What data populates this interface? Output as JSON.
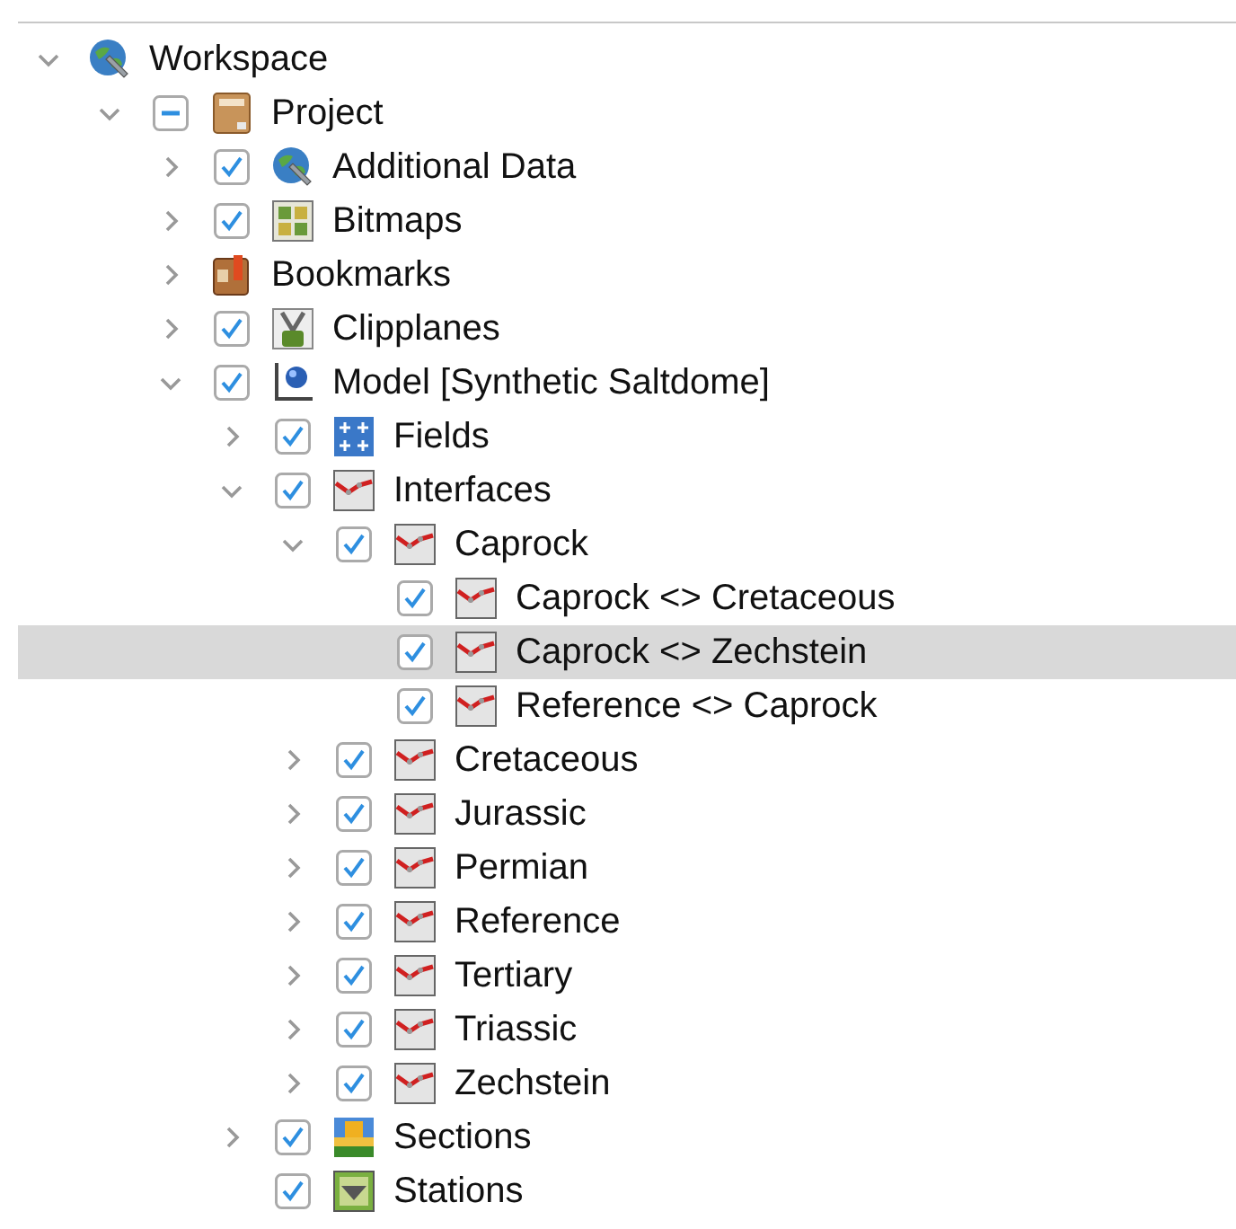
{
  "tree": [
    {
      "label": "Workspace",
      "kind": "workspace",
      "expanded": true,
      "selected": false,
      "children": [
        {
          "label": "Project",
          "kind": "project",
          "partial": true,
          "expanded": true,
          "selected": false,
          "children": [
            {
              "label": "Additional Data",
              "kind": "workspace",
              "checked": true,
              "expanded": false,
              "selected": false
            },
            {
              "label": "Bitmaps",
              "kind": "bitmap",
              "checked": true,
              "expanded": false,
              "selected": false
            },
            {
              "label": "Bookmarks",
              "kind": "bookmark",
              "expanded": false,
              "selected": false
            },
            {
              "label": "Clipplanes",
              "kind": "clipplane",
              "checked": true,
              "expanded": false,
              "selected": false
            },
            {
              "label": "Model [Synthetic Saltdome]",
              "kind": "model",
              "checked": true,
              "expanded": true,
              "selected": false,
              "children": [
                {
                  "label": "Fields",
                  "kind": "field",
                  "checked": true,
                  "expanded": false,
                  "selected": false
                },
                {
                  "label": "Interfaces",
                  "kind": "interface",
                  "checked": true,
                  "expanded": true,
                  "selected": false,
                  "children": [
                    {
                      "label": "Caprock",
                      "kind": "interface",
                      "checked": true,
                      "expanded": true,
                      "selected": false,
                      "children": [
                        {
                          "label": "Caprock <> Cretaceous",
                          "kind": "interface",
                          "checked": true,
                          "selected": false
                        },
                        {
                          "label": "Caprock <> Zechstein",
                          "kind": "interface",
                          "checked": true,
                          "selected": true
                        },
                        {
                          "label": "Reference <> Caprock",
                          "kind": "interface",
                          "checked": true,
                          "selected": false
                        }
                      ]
                    },
                    {
                      "label": "Cretaceous",
                      "kind": "interface",
                      "checked": true,
                      "expanded": false,
                      "selected": false
                    },
                    {
                      "label": "Jurassic",
                      "kind": "interface",
                      "checked": true,
                      "expanded": false,
                      "selected": false
                    },
                    {
                      "label": "Permian",
                      "kind": "interface",
                      "checked": true,
                      "expanded": false,
                      "selected": false
                    },
                    {
                      "label": "Reference",
                      "kind": "interface",
                      "checked": true,
                      "expanded": false,
                      "selected": false
                    },
                    {
                      "label": "Tertiary",
                      "kind": "interface",
                      "checked": true,
                      "expanded": false,
                      "selected": false
                    },
                    {
                      "label": "Triassic",
                      "kind": "interface",
                      "checked": true,
                      "expanded": false,
                      "selected": false
                    },
                    {
                      "label": "Zechstein",
                      "kind": "interface",
                      "checked": true,
                      "expanded": false,
                      "selected": false
                    }
                  ]
                },
                {
                  "label": "Sections",
                  "kind": "section",
                  "checked": true,
                  "expanded": false,
                  "selected": false
                },
                {
                  "label": "Stations",
                  "kind": "station",
                  "checked": true,
                  "selected": false
                }
              ]
            }
          ]
        }
      ]
    }
  ]
}
